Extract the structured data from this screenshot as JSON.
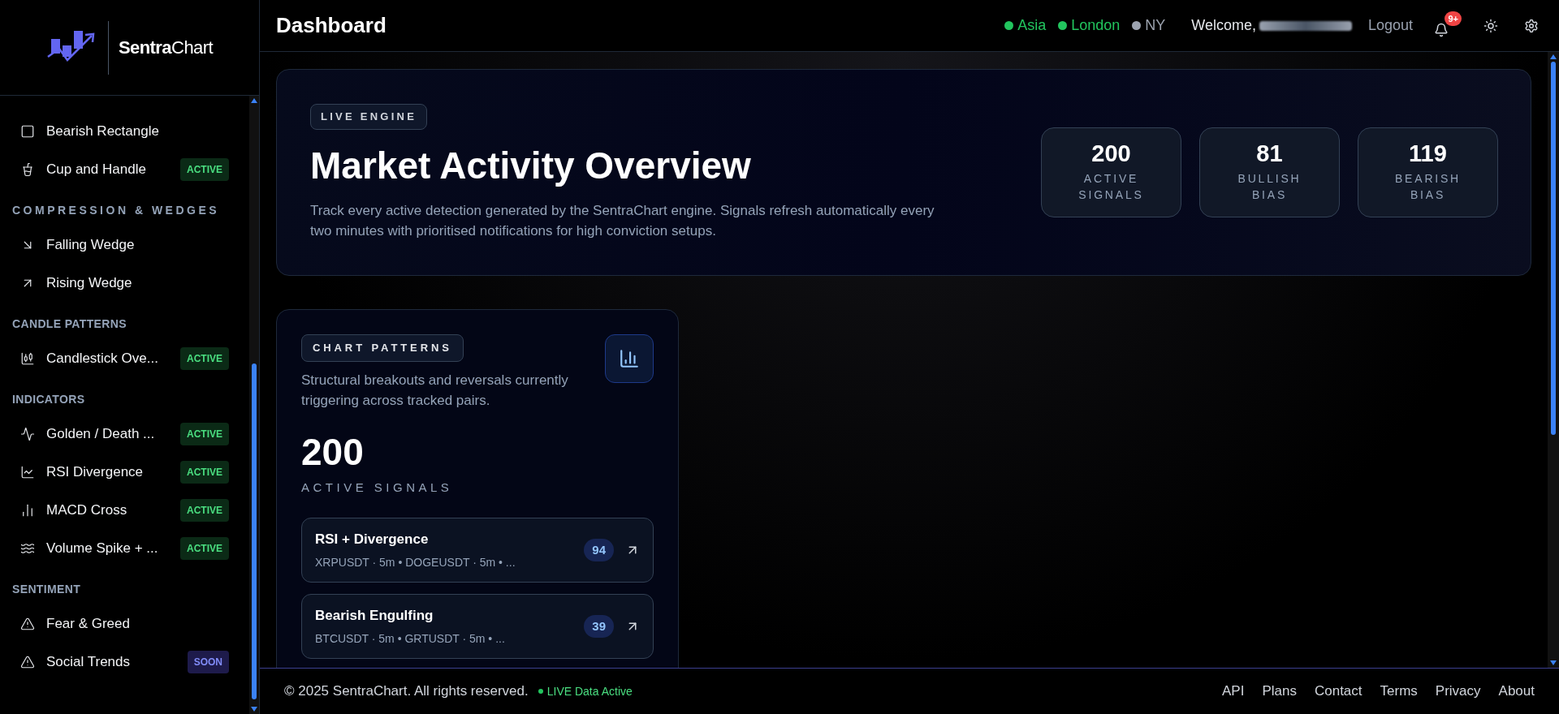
{
  "brand": {
    "name": "**Sentra**Chart"
  },
  "sidebar": {
    "entries": [
      {
        "kind": "item",
        "label": "Bearish Rectangle"
      },
      {
        "kind": "item",
        "label": "Cup and Handle",
        "badge": {
          "text": "ACTIVE",
          "kind": "active"
        }
      },
      {
        "kind": "wide-header",
        "label": "COMPRESSION & WEDGES"
      },
      {
        "kind": "item",
        "label": "Falling Wedge"
      },
      {
        "kind": "item",
        "label": "Rising Wedge"
      },
      {
        "kind": "header",
        "label": "CANDLE PATTERNS"
      },
      {
        "kind": "item",
        "label": "Candlestick Ove...",
        "badge": {
          "text": "ACTIVE",
          "kind": "active"
        }
      },
      {
        "kind": "header",
        "label": "INDICATORS"
      },
      {
        "kind": "item",
        "label": "Golden / Death ...",
        "badge": {
          "text": "ACTIVE",
          "kind": "active"
        }
      },
      {
        "kind": "item",
        "label": "RSI Divergence",
        "badge": {
          "text": "ACTIVE",
          "kind": "active"
        }
      },
      {
        "kind": "item",
        "label": "MACD Cross",
        "badge": {
          "text": "ACTIVE",
          "kind": "active"
        }
      },
      {
        "kind": "item",
        "label": "Volume Spike + ...",
        "badge": {
          "text": "ACTIVE",
          "kind": "active"
        }
      },
      {
        "kind": "header",
        "label": "SENTIMENT"
      },
      {
        "kind": "item",
        "label": "Fear & Greed"
      },
      {
        "kind": "item",
        "label": "Social Trends",
        "badge": {
          "text": "SOON",
          "kind": "soon"
        }
      }
    ]
  },
  "header": {
    "title": "Dashboard",
    "sessions": [
      {
        "label": "Asia",
        "color": "#22c55e"
      },
      {
        "label": "London",
        "color": "#22c55e"
      },
      {
        "label": "NY",
        "color": "#9ca3af"
      }
    ],
    "welcome": "Welcome,",
    "logout": "Logout",
    "notifications": "9+"
  },
  "hero": {
    "pill": "LIVE ENGINE",
    "title": "Market Activity Overview",
    "description": "Track every active detection generated by the SentraChart engine. Signals refresh automatically every two minutes with prioritised notifications for high conviction setups.",
    "stats": [
      {
        "value": "200",
        "label": "ACTIVE SIGNALS"
      },
      {
        "value": "81",
        "label": "BULLISH BIAS"
      },
      {
        "value": "119",
        "label": "BEARISH BIAS"
      }
    ]
  },
  "card": {
    "pill": "CHART PATTERNS",
    "description": "Structural breakouts and reversals currently triggering across tracked pairs.",
    "count": "200",
    "count_label": "ACTIVE SIGNALS",
    "signals": [
      {
        "name": "RSI + Divergence",
        "pairs": "XRPUSDT · 5m • DOGEUSDT · 5m • ...",
        "count": "94"
      },
      {
        "name": "Bearish Engulfing",
        "pairs": "BTCUSDT · 5m • GRTUSDT · 5m • ...",
        "count": "39"
      }
    ]
  },
  "footer": {
    "copyright": "© 2025 SentraChart. All rights reserved.",
    "live": "LIVE Data Active",
    "links": [
      "API",
      "Plans",
      "Contact",
      "Terms",
      "Privacy",
      "About"
    ]
  }
}
